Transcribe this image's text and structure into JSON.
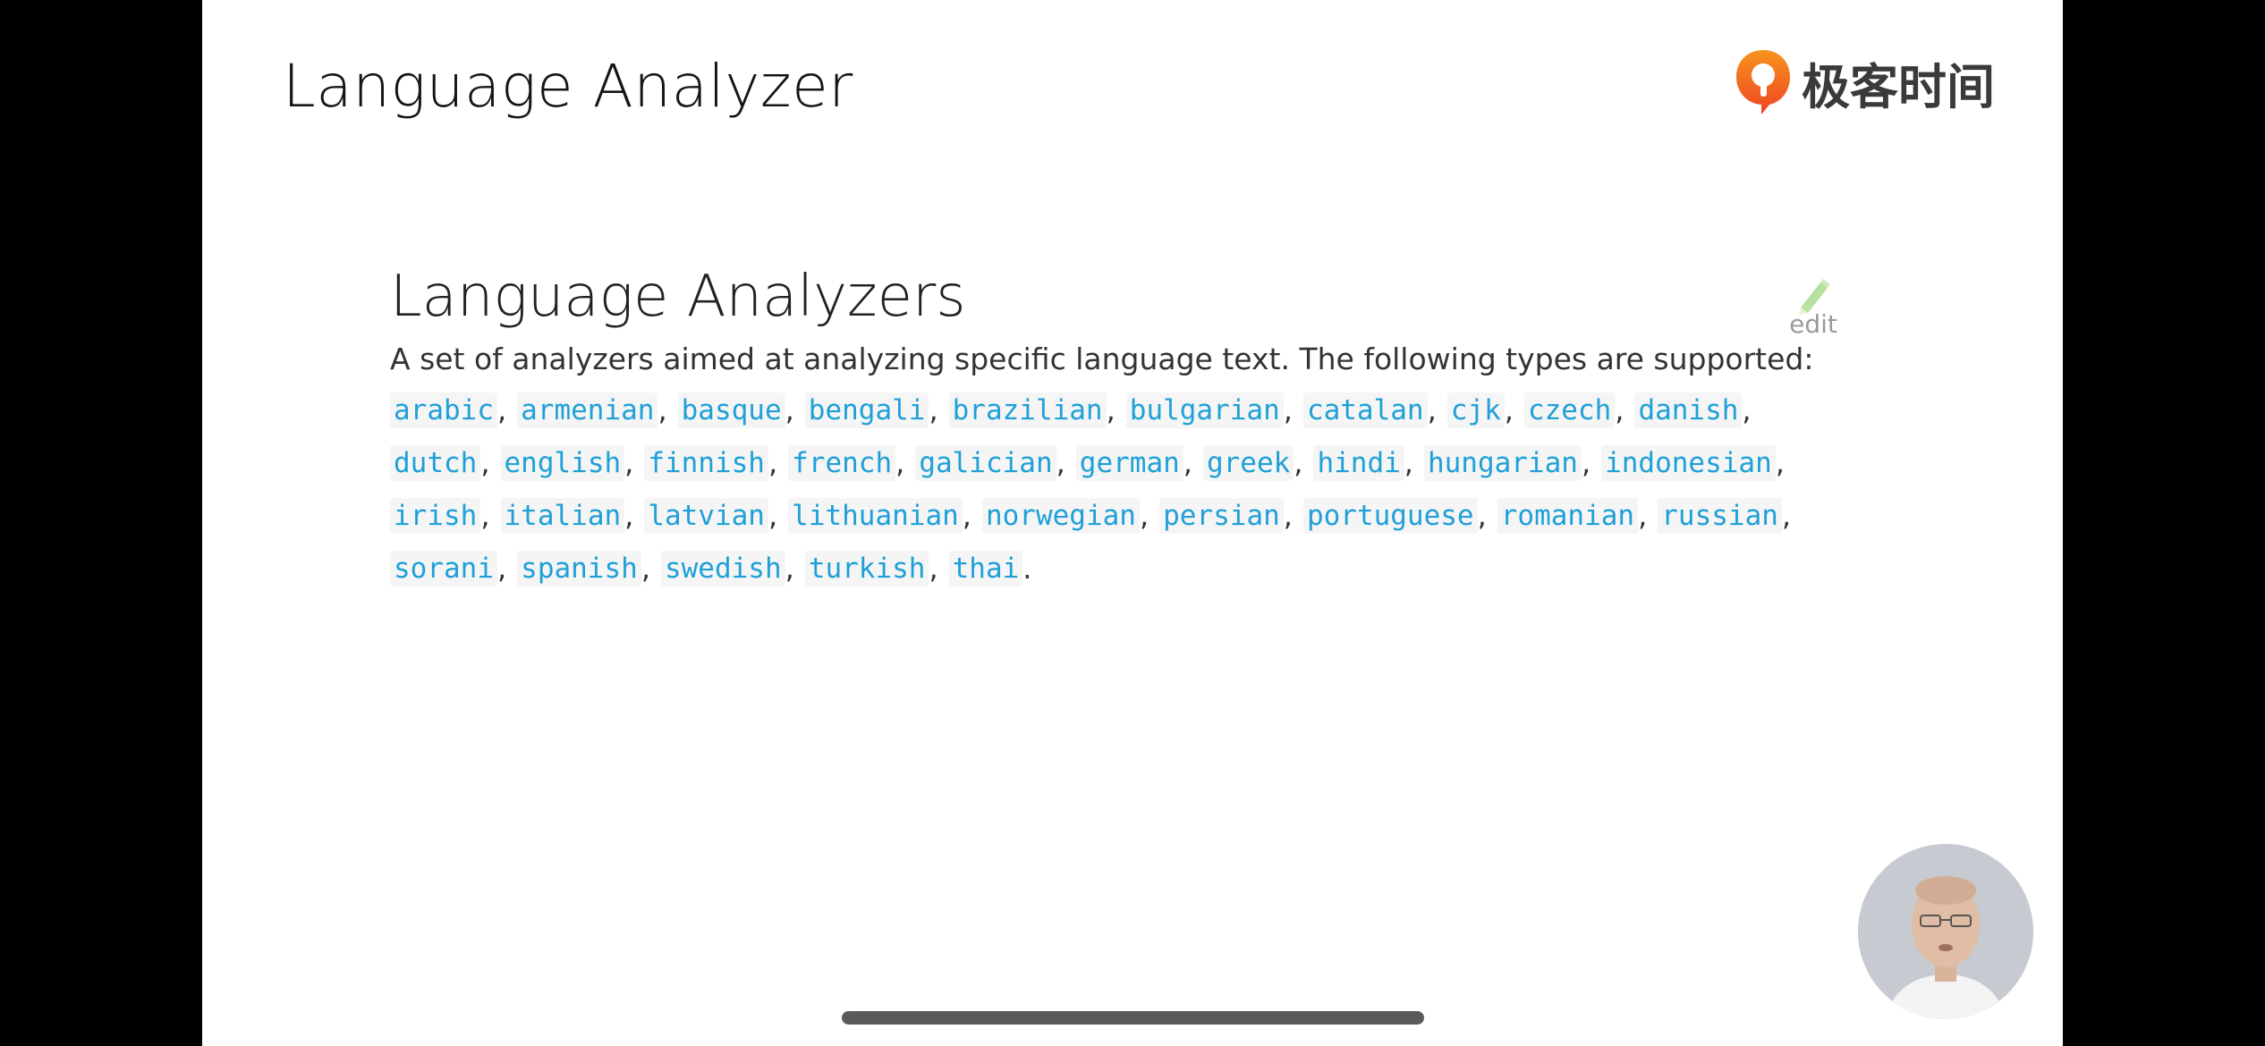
{
  "slide": {
    "title": "Language Analyzer",
    "brand_name": "极客时间",
    "brand_logo": "geektime-logo"
  },
  "doc": {
    "heading": "Language Analyzers",
    "edit_label": "edit",
    "edit_icon": "pencil-icon",
    "intro": "A set of analyzers aimed at analyzing specific language text. The following types are supported:",
    "analyzer_lines": [
      [
        "arabic",
        "armenian",
        "basque",
        "bengali",
        "brazilian",
        "bulgarian",
        "catalan",
        "cjk",
        "czech",
        "danish"
      ],
      [
        "dutch",
        "english",
        "finnish",
        "french",
        "galician",
        "german",
        "greek",
        "hindi",
        "hungarian",
        "indonesian"
      ],
      [
        "irish",
        "italian",
        "latvian",
        "lithuanian",
        "norwegian",
        "persian",
        "portuguese",
        "romanian",
        "russian"
      ],
      [
        "sorani",
        "spanish",
        "swedish",
        "turkish",
        "thai"
      ]
    ],
    "separator": ",",
    "terminator": "."
  },
  "overlay": {
    "presenter": "presenter-webcam",
    "home_indicator": "home-indicator"
  },
  "colors": {
    "code_text": "#1fa0d8",
    "code_bg": "#f5f5f5",
    "brand_accent": "#f4511e",
    "background": "#000000",
    "slide": "#ffffff"
  }
}
